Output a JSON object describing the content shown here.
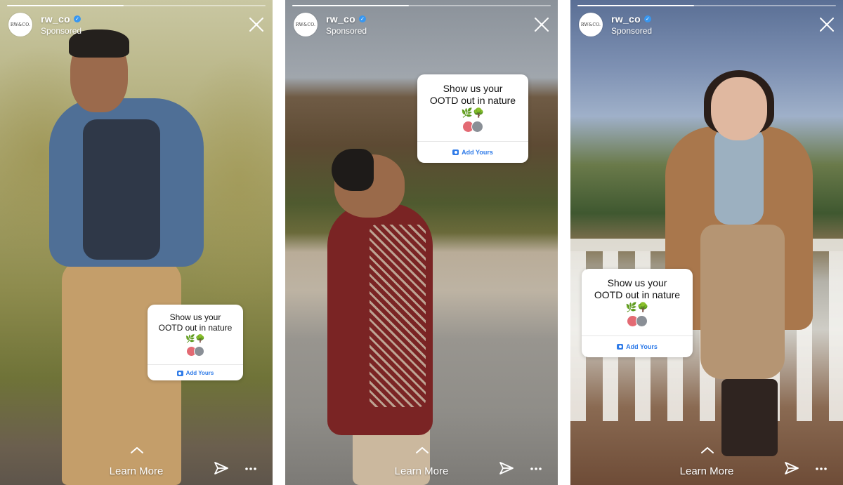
{
  "stories": [
    {
      "account": {
        "username": "rw_co",
        "avatar_text": "RW&CO.",
        "verified": true,
        "sponsored_label": "Sponsored"
      },
      "progress": 0.45,
      "sticker": {
        "title_line1": "Show us your",
        "title_line2": "OOTD out in nature",
        "emoji": "🌿🌳",
        "action_label": "Add Yours"
      },
      "cta": {
        "label": "Learn More"
      },
      "icons": {
        "close": "close-icon",
        "send": "send-icon",
        "more": "more-icon",
        "chevron": "chevron-up-icon"
      }
    },
    {
      "account": {
        "username": "rw_co",
        "avatar_text": "RW&CO.",
        "verified": true,
        "sponsored_label": "Sponsored"
      },
      "progress": 0.45,
      "sticker": {
        "title_line1": "Show us your",
        "title_line2": "OOTD out in nature",
        "emoji": "🌿🌳",
        "action_label": "Add Yours"
      },
      "cta": {
        "label": "Learn More"
      },
      "icons": {
        "close": "close-icon",
        "send": "send-icon",
        "more": "more-icon",
        "chevron": "chevron-up-icon"
      }
    },
    {
      "account": {
        "username": "rw_co",
        "avatar_text": "RW&CO.",
        "verified": true,
        "sponsored_label": "Sponsored"
      },
      "progress": 0.45,
      "sticker": {
        "title_line1": "Show us your",
        "title_line2": "OOTD out in nature",
        "emoji": "🌿🌳",
        "action_label": "Add Yours"
      },
      "cta": {
        "label": "Learn More"
      },
      "icons": {
        "close": "close-icon",
        "send": "send-icon",
        "more": "more-icon",
        "chevron": "chevron-up-icon"
      }
    }
  ],
  "colors": {
    "verified_badge": "#3897f0",
    "action_blue": "#2f7be8",
    "overlay_text": "#ffffff"
  }
}
